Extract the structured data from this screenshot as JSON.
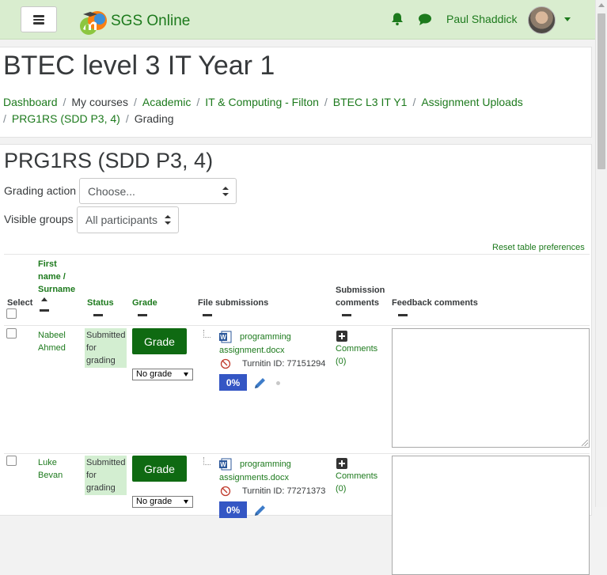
{
  "navbar": {
    "menu_icon": "hamburger-icon",
    "site_name": "SGS Online",
    "notifications_icon": "bell-icon",
    "messages_icon": "chat-icon",
    "user_name": "Paul Shaddick",
    "accent_color": "#1d7a1d"
  },
  "header": {
    "course_title": "BTEC level 3 IT Year 1",
    "breadcrumb": [
      "Dashboard",
      "My courses",
      "Academic",
      "IT & Computing - Filton",
      "BTEC L3 IT Y1",
      "Assignment Uploads",
      "PRG1RS (SDD P3, 4)",
      "Grading"
    ]
  },
  "main": {
    "heading": "PRG1RS (SDD P3, 4)",
    "grading_action_label": "Grading action",
    "grading_action_value": "Choose...",
    "visible_groups_label": "Visible groups",
    "visible_groups_value": "All participants",
    "reset_link": "Reset table preferences"
  },
  "table": {
    "headers": {
      "select": "Select",
      "name": "First name / Surname",
      "status": "Status",
      "grade": "Grade",
      "files": "File submissions",
      "sub_comments": "Submission comments",
      "feedback": "Feedback comments"
    },
    "rows": [
      {
        "first": "Nabeel",
        "last": "Ahmed",
        "status": "Submitted for grading",
        "grade_button": "Grade",
        "grade_value": "No grade",
        "file": "programming assignment.docx",
        "turnitin": "Turnitin ID: 77151294",
        "similarity": "0%",
        "comments": "Comments (0)"
      },
      {
        "first": "Luke",
        "last": "Bevan",
        "status": "Submitted for grading",
        "grade_button": "Grade",
        "grade_value": "No grade",
        "file": "programming assignments.docx",
        "turnitin": "Turnitin ID: 77271373",
        "similarity": "0%",
        "comments": "Comments (0)"
      }
    ]
  }
}
